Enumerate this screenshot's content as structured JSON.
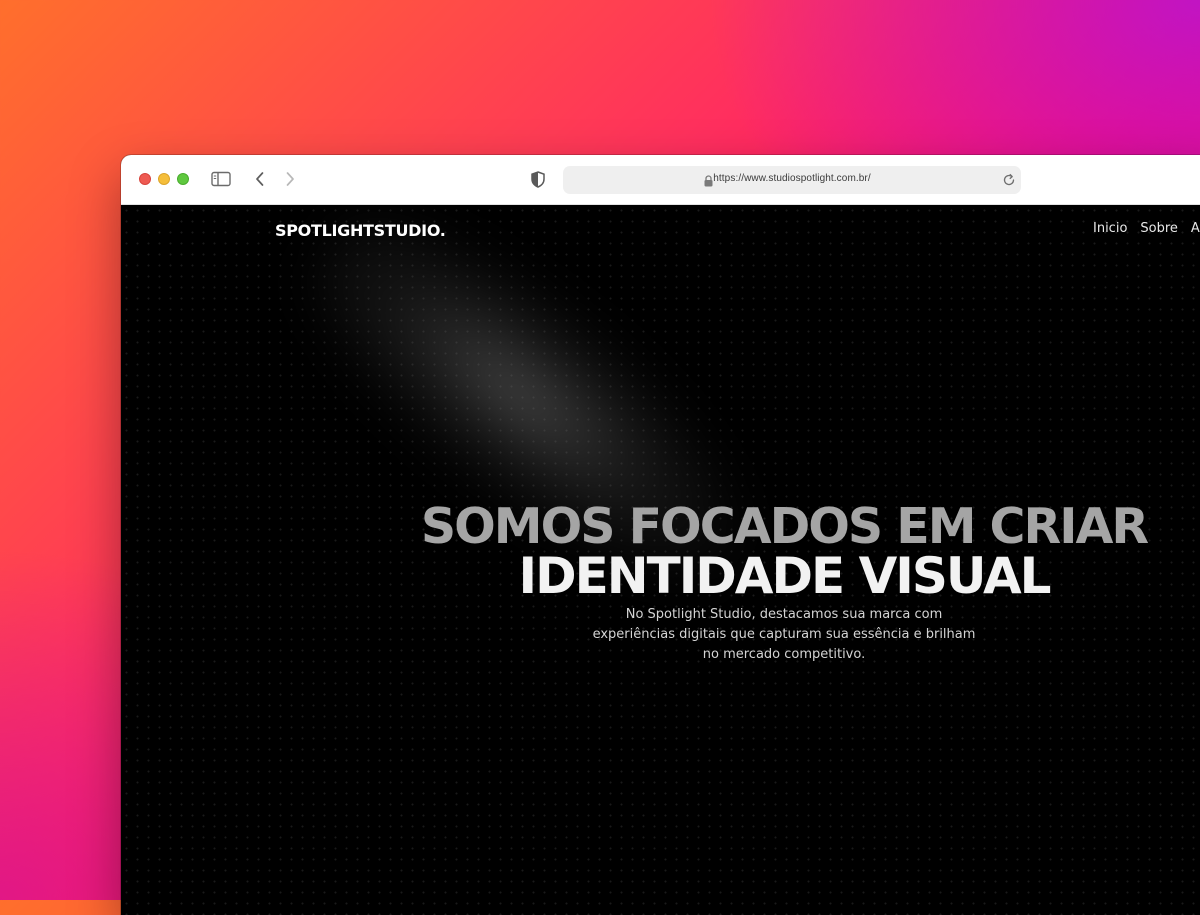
{
  "browser": {
    "url": "https://www.studiospotlight.com.br/",
    "icons": {
      "sidebar": "sidebar-icon",
      "back": "chevron-left-icon",
      "forward": "chevron-right-icon",
      "privacy": "shield-icon",
      "lock": "lock-icon",
      "reload": "reload-icon"
    }
  },
  "site": {
    "logo": "SPOTLIGHTSTUDIO.",
    "nav": [
      "Inicio",
      "Sobre",
      "Ativ"
    ],
    "headline_line1": "SOMOS FOCADOS EM CRIAR",
    "headline_line2": "IDENTIDADE VISUAL",
    "subtitle_line1": "No Spotlight Studio, destacamos sua marca com",
    "subtitle_line2": "experiências digitais que capturam sua essência e brilham",
    "subtitle_line3": "no mercado competitivo."
  },
  "colors": {
    "page_background": "#000000",
    "headline_line1": "#a5a5a5",
    "headline_line2": "#f2f2f2",
    "backdrop_gradient": [
      "#ff6f2c",
      "#ff0a6c",
      "#b312b3"
    ]
  }
}
